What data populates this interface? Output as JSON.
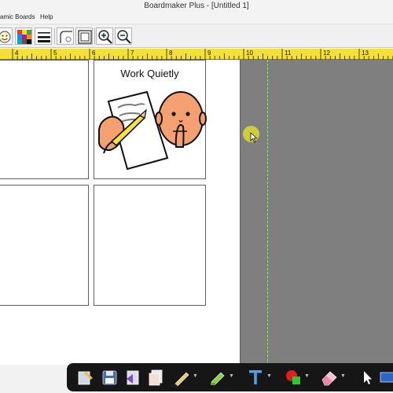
{
  "window": {
    "title": "Boardmaker Plus - [Untitled 1]"
  },
  "menu": {
    "items": [
      "amic Boards",
      "Help"
    ]
  },
  "toolbar": {
    "buttons": [
      {
        "name": "symbol-finder-icon"
      },
      {
        "name": "color-palette-icon"
      },
      {
        "name": "line-thickness-icon"
      },
      {
        "name": "corner-style-icon"
      },
      {
        "name": "border-frame-icon"
      },
      {
        "name": "zoom-in-icon"
      },
      {
        "name": "zoom-out-icon"
      }
    ]
  },
  "ruler": {
    "labels": [
      "4",
      "5",
      "6",
      "7",
      "8",
      "9",
      "10",
      "11",
      "12",
      "13"
    ]
  },
  "board": {
    "cells": [
      {
        "label": ""
      },
      {
        "label": "Work Quietly",
        "symbol": "work-quietly-symbol"
      },
      {
        "label": ""
      },
      {
        "label": ""
      }
    ]
  },
  "floating_toolbar": {
    "tools": [
      "pen-pointer-icon",
      "floppy-save-icon",
      "page-arrow-icon",
      "page-stack-icon",
      "pencil-icon",
      "highlighter-icon",
      "text-tool-icon",
      "shape-fill-icon",
      "eraser-icon",
      "select-arrow-icon",
      "screen-icon"
    ]
  },
  "colors": {
    "ruler": "#f5e03a",
    "workspace_gray": "#7f7f7f",
    "cursor_halo": "#d9d930",
    "floating_toolbar": "#161616"
  }
}
